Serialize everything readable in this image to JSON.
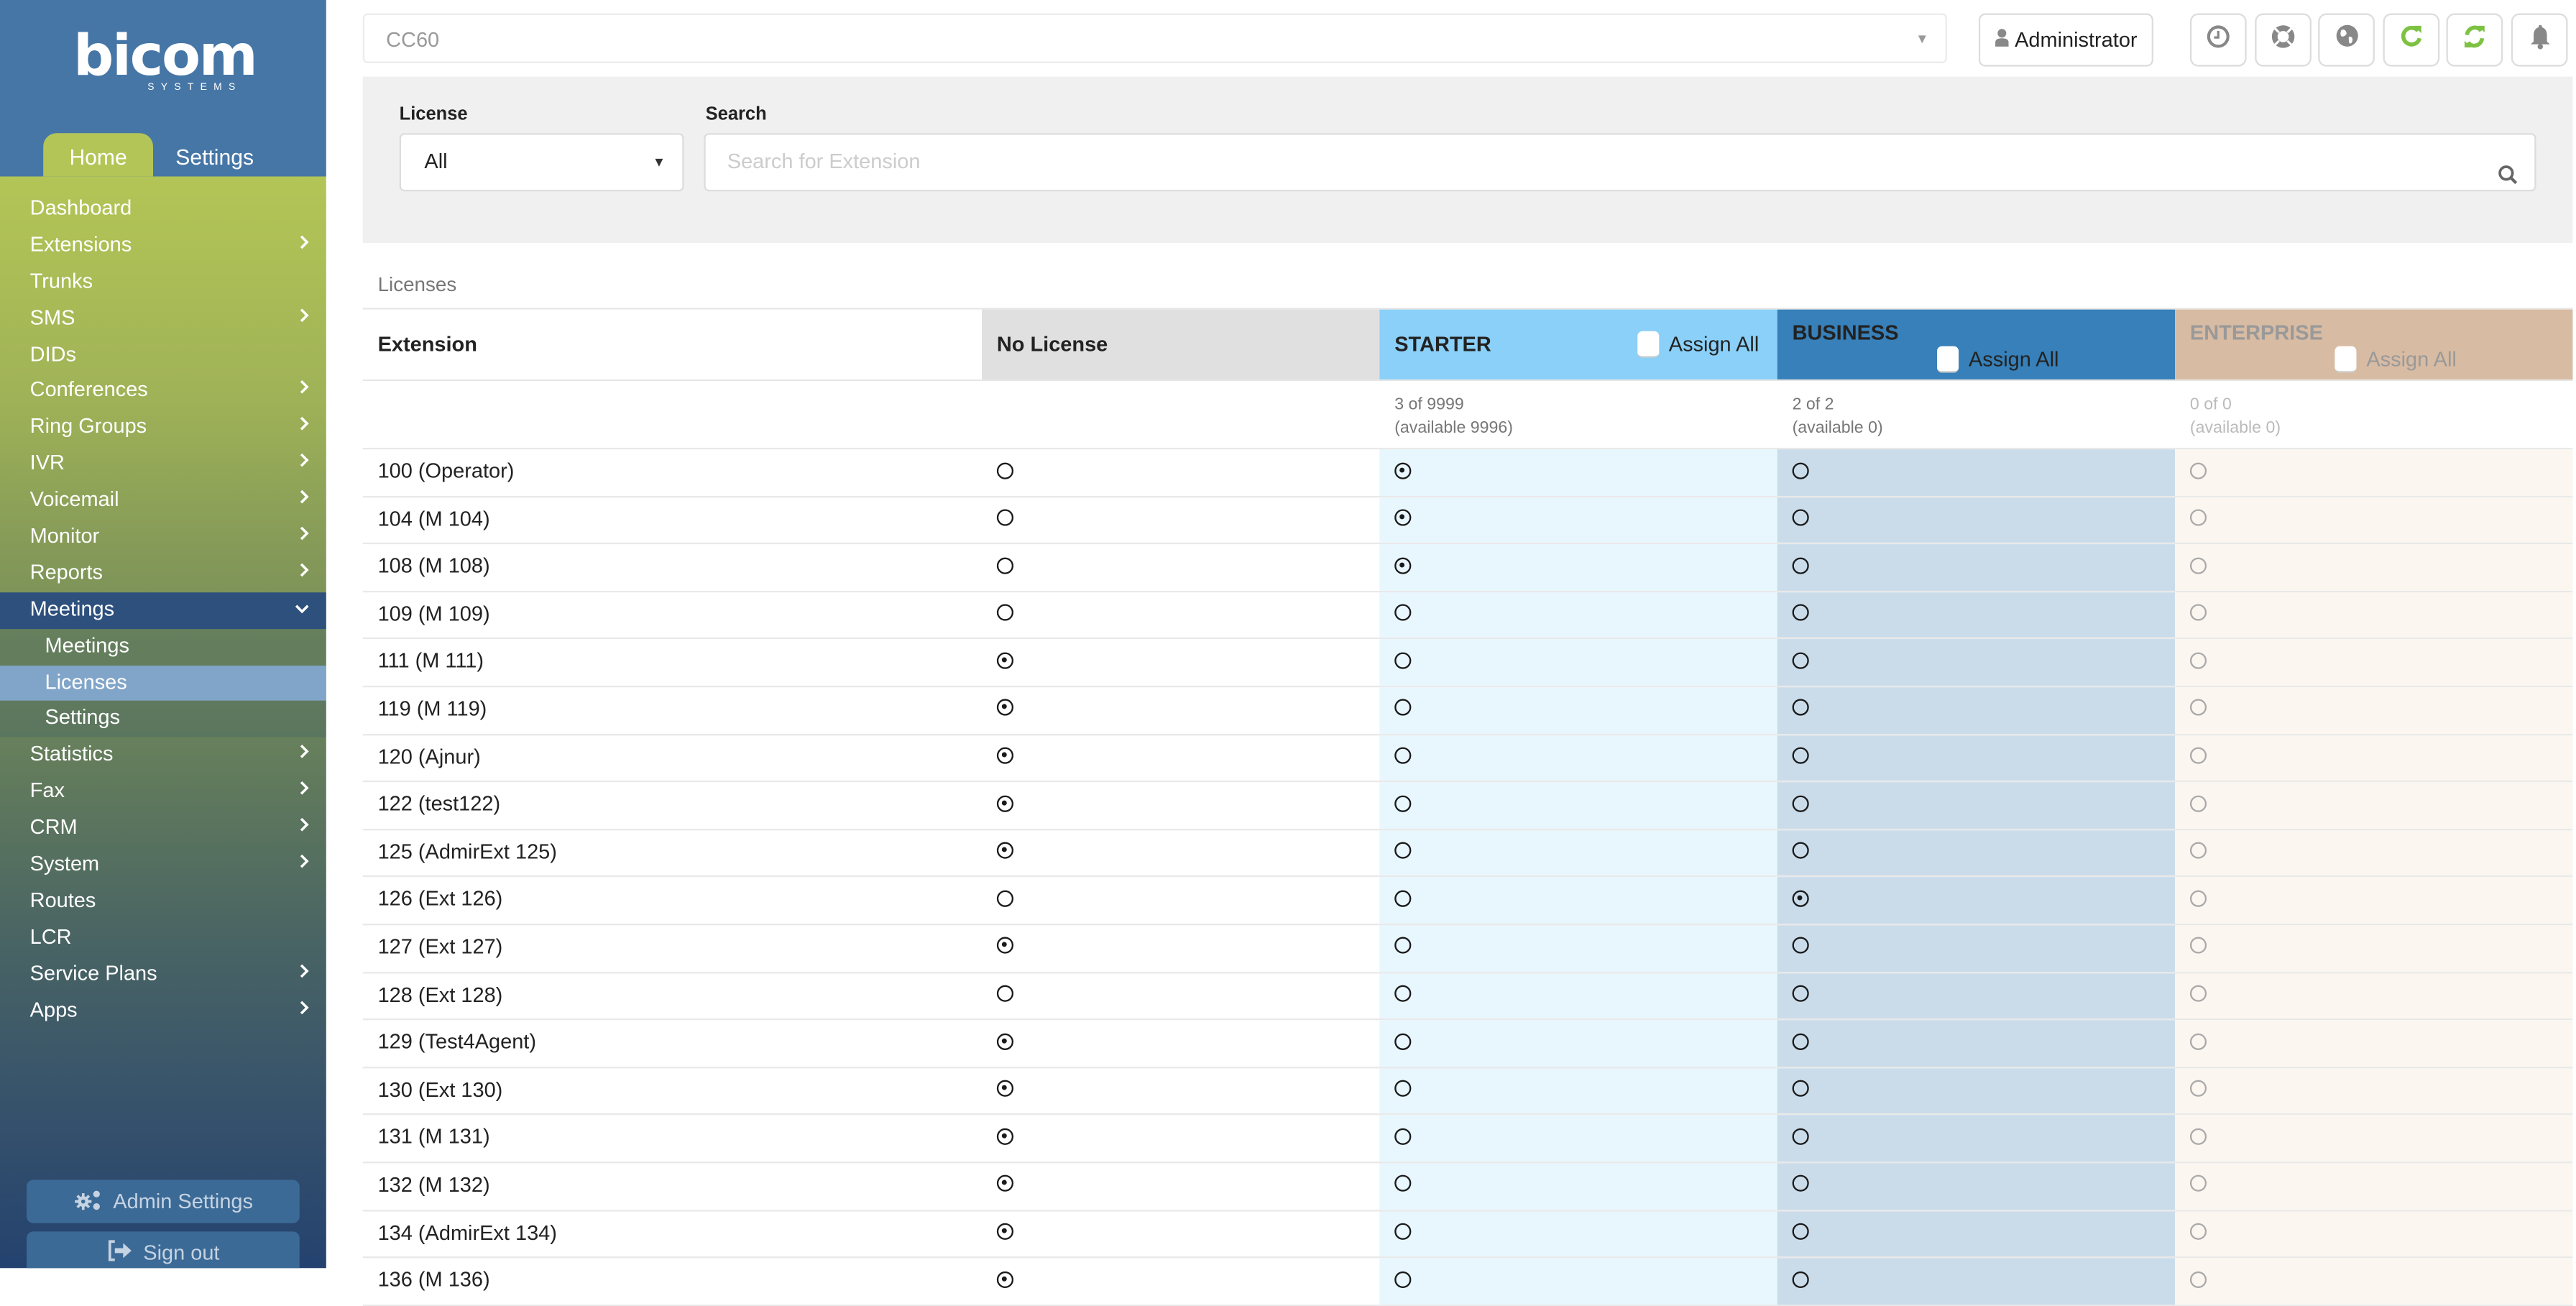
{
  "brand": {
    "name": "bicom",
    "tagline": "SYSTEMS"
  },
  "sidebar": {
    "tabs": [
      {
        "label": "Home",
        "active": true
      },
      {
        "label": "Settings",
        "active": false
      }
    ],
    "items": [
      {
        "label": "Dashboard",
        "has_children": false
      },
      {
        "label": "Extensions",
        "has_children": true
      },
      {
        "label": "Trunks",
        "has_children": false
      },
      {
        "label": "SMS",
        "has_children": true
      },
      {
        "label": "DIDs",
        "has_children": false
      },
      {
        "label": "Conferences",
        "has_children": true
      },
      {
        "label": "Ring Groups",
        "has_children": true
      },
      {
        "label": "IVR",
        "has_children": true
      },
      {
        "label": "Voicemail",
        "has_children": true
      },
      {
        "label": "Monitor",
        "has_children": true
      },
      {
        "label": "Reports",
        "has_children": true
      },
      {
        "label": "Meetings",
        "has_children": true,
        "expanded": true,
        "children": [
          {
            "label": "Meetings"
          },
          {
            "label": "Licenses",
            "active": true
          },
          {
            "label": "Settings"
          }
        ]
      },
      {
        "label": "Statistics",
        "has_children": true
      },
      {
        "label": "Fax",
        "has_children": true
      },
      {
        "label": "CRM",
        "has_children": true
      },
      {
        "label": "System",
        "has_children": true
      },
      {
        "label": "Routes",
        "has_children": false
      },
      {
        "label": "LCR",
        "has_children": false
      },
      {
        "label": "Service Plans",
        "has_children": true
      },
      {
        "label": "Apps",
        "has_children": true
      }
    ],
    "admin_settings_label": "Admin Settings",
    "sign_out_label": "Sign out"
  },
  "topbar": {
    "pbx_selector_value": "CC60",
    "user_label": "Administrator",
    "icons": [
      "clock-icon",
      "life-ring-icon",
      "globe-icon",
      "redo-icon",
      "sync-icon",
      "bell-icon"
    ],
    "accent_green": "#7dc242"
  },
  "filter": {
    "license_label": "License",
    "license_value": "All",
    "search_label": "Search",
    "search_placeholder": "Search for Extension",
    "search_value": ""
  },
  "table": {
    "section_title": "Licenses",
    "columns": {
      "extension": "Extension",
      "no_license": "No License",
      "starter": {
        "label": "STARTER",
        "assign_all": "Assign All",
        "count": "3 of 9999",
        "available": "(available 9996)",
        "color": "#8ad0f8"
      },
      "business": {
        "label": "BUSINESS",
        "assign_all": "Assign All",
        "count": "2 of 2",
        "available": "(available 0)",
        "color": "#3780b9"
      },
      "enterprise": {
        "label": "ENTERPRISE",
        "assign_all": "Assign All",
        "count": "0 of 0",
        "available": "(available 0)",
        "color": "#d8bba3",
        "disabled": true
      }
    },
    "rows": [
      {
        "extension": "100 (Operator)",
        "license": "starter"
      },
      {
        "extension": "104 (M 104)",
        "license": "starter"
      },
      {
        "extension": "108 (M 108)",
        "license": "starter"
      },
      {
        "extension": "109 (M 109)",
        "license": ""
      },
      {
        "extension": "111 (M 111)",
        "license": "none"
      },
      {
        "extension": "119 (M 119)",
        "license": "none"
      },
      {
        "extension": "120 (Ajnur)",
        "license": "none"
      },
      {
        "extension": "122 (test122)",
        "license": "none"
      },
      {
        "extension": "125 (AdmirExt 125)",
        "license": "none"
      },
      {
        "extension": "126 (Ext 126)",
        "license": "business"
      },
      {
        "extension": "127 (Ext 127)",
        "license": "none"
      },
      {
        "extension": "128 (Ext 128)",
        "license": ""
      },
      {
        "extension": "129 (Test4Agent)",
        "license": "none"
      },
      {
        "extension": "130 (Ext 130)",
        "license": "none"
      },
      {
        "extension": "131 (M 131)",
        "license": "none"
      },
      {
        "extension": "132 (M 132)",
        "license": "none"
      },
      {
        "extension": "134 (AdmirExt 134)",
        "license": "none"
      },
      {
        "extension": "136 (M 136)",
        "license": "none"
      }
    ]
  }
}
